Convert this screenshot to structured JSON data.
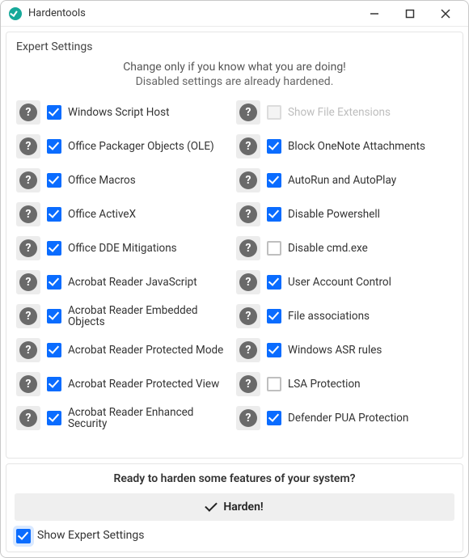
{
  "window": {
    "title": "Hardentools"
  },
  "panel": {
    "title": "Expert Settings",
    "intro_line1": "Change only if you know what you are doing!",
    "intro_line2": "Disabled settings are already hardened."
  },
  "settings_left": [
    {
      "label": "Windows Script Host",
      "checked": true,
      "disabled": false
    },
    {
      "label": "Office Packager Objects (OLE)",
      "checked": true,
      "disabled": false
    },
    {
      "label": "Office Macros",
      "checked": true,
      "disabled": false
    },
    {
      "label": "Office ActiveX",
      "checked": true,
      "disabled": false
    },
    {
      "label": "Office DDE Mitigations",
      "checked": true,
      "disabled": false
    },
    {
      "label": "Acrobat Reader JavaScript",
      "checked": true,
      "disabled": false
    },
    {
      "label": "Acrobat Reader Embedded Objects",
      "checked": true,
      "disabled": false
    },
    {
      "label": "Acrobat Reader Protected Mode",
      "checked": true,
      "disabled": false
    },
    {
      "label": "Acrobat Reader Protected View",
      "checked": true,
      "disabled": false
    },
    {
      "label": "Acrobat Reader Enhanced Security",
      "checked": true,
      "disabled": false
    }
  ],
  "settings_right": [
    {
      "label": "Show File Extensions",
      "checked": false,
      "disabled": true
    },
    {
      "label": "Block OneNote Attachments",
      "checked": true,
      "disabled": false
    },
    {
      "label": "AutoRun and AutoPlay",
      "checked": true,
      "disabled": false
    },
    {
      "label": "Disable Powershell",
      "checked": true,
      "disabled": false
    },
    {
      "label": "Disable cmd.exe",
      "checked": false,
      "disabled": false
    },
    {
      "label": "User Account Control",
      "checked": true,
      "disabled": false
    },
    {
      "label": "File associations",
      "checked": true,
      "disabled": false
    },
    {
      "label": "Windows ASR rules",
      "checked": true,
      "disabled": false
    },
    {
      "label": "LSA Protection",
      "checked": false,
      "disabled": false
    },
    {
      "label": "Defender PUA Protection",
      "checked": true,
      "disabled": false
    }
  ],
  "footer": {
    "title": "Ready to harden some features of your system?",
    "button": "Harden!",
    "show_expert_label": "Show Expert Settings",
    "show_expert_checked": true
  }
}
